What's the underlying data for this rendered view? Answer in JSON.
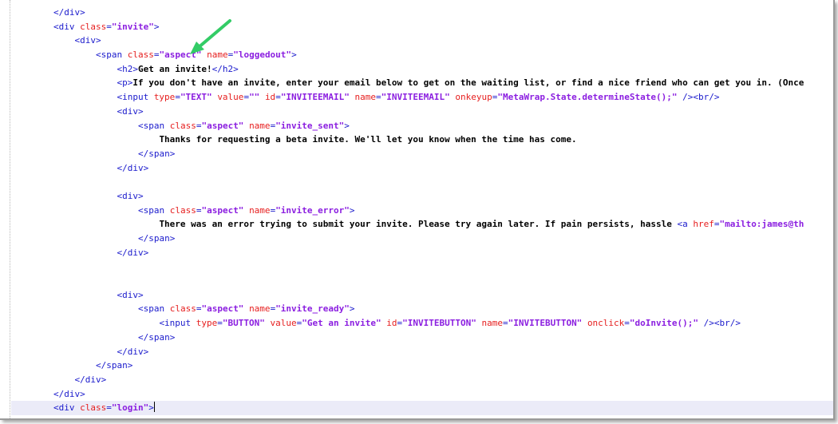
{
  "editor": {
    "accent_arrow_color": "#33cc66",
    "lines": [
      {
        "indent": "        ",
        "parts": [
          [
            "tag",
            "</div>"
          ]
        ]
      },
      {
        "indent": "        ",
        "parts": [
          [
            "tag",
            "<div "
          ],
          [
            "attr",
            "class"
          ],
          [
            "tag",
            "="
          ],
          [
            "val",
            "\"invite\""
          ],
          [
            "tag",
            ">"
          ]
        ]
      },
      {
        "indent": "            ",
        "parts": [
          [
            "tag",
            "<div>"
          ]
        ]
      },
      {
        "indent": "                ",
        "parts": [
          [
            "tag",
            "<span "
          ],
          [
            "attr",
            "class"
          ],
          [
            "tag",
            "="
          ],
          [
            "val",
            "\"aspect\""
          ],
          [
            "tag",
            " "
          ],
          [
            "attr",
            "name"
          ],
          [
            "tag",
            "="
          ],
          [
            "val",
            "\"loggedout\""
          ],
          [
            "tag",
            ">"
          ]
        ]
      },
      {
        "indent": "                    ",
        "parts": [
          [
            "tag",
            "<h2>"
          ],
          [
            "txt",
            "Get an invite!"
          ],
          [
            "tag",
            "</h2>"
          ]
        ]
      },
      {
        "indent": "                    ",
        "parts": [
          [
            "tag",
            "<p>"
          ],
          [
            "txt",
            "If you don't have an invite, enter your email below to get on the waiting list, or find a nice friend who can get you in. (Once"
          ]
        ]
      },
      {
        "indent": "                    ",
        "parts": [
          [
            "tag",
            "<input "
          ],
          [
            "attr",
            "type"
          ],
          [
            "tag",
            "="
          ],
          [
            "val",
            "\"TEXT\""
          ],
          [
            "tag",
            " "
          ],
          [
            "attr",
            "value"
          ],
          [
            "tag",
            "="
          ],
          [
            "val",
            "\"\""
          ],
          [
            "tag",
            " "
          ],
          [
            "attr",
            "id"
          ],
          [
            "tag",
            "="
          ],
          [
            "val",
            "\"INVITEEMAIL\""
          ],
          [
            "tag",
            " "
          ],
          [
            "attr",
            "name"
          ],
          [
            "tag",
            "="
          ],
          [
            "val",
            "\"INVITEEMAIL\""
          ],
          [
            "tag",
            " "
          ],
          [
            "attr",
            "onkeyup"
          ],
          [
            "tag",
            "="
          ],
          [
            "val",
            "\"MetaWrap.State.determineState();\""
          ],
          [
            "tag",
            " /><br/>"
          ]
        ]
      },
      {
        "indent": "                    ",
        "parts": [
          [
            "tag",
            "<div>"
          ]
        ]
      },
      {
        "indent": "                        ",
        "parts": [
          [
            "tag",
            "<span "
          ],
          [
            "attr",
            "class"
          ],
          [
            "tag",
            "="
          ],
          [
            "val",
            "\"aspect\""
          ],
          [
            "tag",
            " "
          ],
          [
            "attr",
            "name"
          ],
          [
            "tag",
            "="
          ],
          [
            "val",
            "\"invite_sent\""
          ],
          [
            "tag",
            ">"
          ]
        ]
      },
      {
        "indent": "                            ",
        "parts": [
          [
            "txt",
            "Thanks for requesting a beta invite. We'll let you know when the time has come."
          ]
        ]
      },
      {
        "indent": "                        ",
        "parts": [
          [
            "tag",
            "</span>"
          ]
        ]
      },
      {
        "indent": "                    ",
        "parts": [
          [
            "tag",
            "</div>"
          ]
        ]
      },
      {
        "indent": "",
        "parts": []
      },
      {
        "indent": "                    ",
        "parts": [
          [
            "tag",
            "<div>"
          ]
        ]
      },
      {
        "indent": "                        ",
        "parts": [
          [
            "tag",
            "<span "
          ],
          [
            "attr",
            "class"
          ],
          [
            "tag",
            "="
          ],
          [
            "val",
            "\"aspect\""
          ],
          [
            "tag",
            " "
          ],
          [
            "attr",
            "name"
          ],
          [
            "tag",
            "="
          ],
          [
            "val",
            "\"invite_error\""
          ],
          [
            "tag",
            ">"
          ]
        ]
      },
      {
        "indent": "                            ",
        "parts": [
          [
            "txt",
            "There was an error trying to submit your invite. Please try again later. If pain persists, hassle "
          ],
          [
            "tag",
            "<a "
          ],
          [
            "attr",
            "href"
          ],
          [
            "tag",
            "="
          ],
          [
            "val",
            "\"mailto:james@th"
          ]
        ]
      },
      {
        "indent": "                        ",
        "parts": [
          [
            "tag",
            "</span>"
          ]
        ]
      },
      {
        "indent": "                    ",
        "parts": [
          [
            "tag",
            "</div>"
          ]
        ]
      },
      {
        "indent": "",
        "parts": []
      },
      {
        "indent": "",
        "parts": []
      },
      {
        "indent": "                    ",
        "parts": [
          [
            "tag",
            "<div>"
          ]
        ]
      },
      {
        "indent": "                        ",
        "parts": [
          [
            "tag",
            "<span "
          ],
          [
            "attr",
            "class"
          ],
          [
            "tag",
            "="
          ],
          [
            "val",
            "\"aspect\""
          ],
          [
            "tag",
            " "
          ],
          [
            "attr",
            "name"
          ],
          [
            "tag",
            "="
          ],
          [
            "val",
            "\"invite_ready\""
          ],
          [
            "tag",
            ">"
          ]
        ]
      },
      {
        "indent": "                            ",
        "parts": [
          [
            "tag",
            "<input "
          ],
          [
            "attr",
            "type"
          ],
          [
            "tag",
            "="
          ],
          [
            "val",
            "\"BUTTON\""
          ],
          [
            "tag",
            " "
          ],
          [
            "attr",
            "value"
          ],
          [
            "tag",
            "="
          ],
          [
            "val",
            "\"Get an invite\""
          ],
          [
            "tag",
            " "
          ],
          [
            "attr",
            "id"
          ],
          [
            "tag",
            "="
          ],
          [
            "val",
            "\"INVITEBUTTON\""
          ],
          [
            "tag",
            " "
          ],
          [
            "attr",
            "name"
          ],
          [
            "tag",
            "="
          ],
          [
            "val",
            "\"INVITEBUTTON\""
          ],
          [
            "tag",
            " "
          ],
          [
            "attr",
            "onclick"
          ],
          [
            "tag",
            "="
          ],
          [
            "val",
            "\"doInvite();\""
          ],
          [
            "tag",
            " /><br/>"
          ]
        ]
      },
      {
        "indent": "                        ",
        "parts": [
          [
            "tag",
            "</span>"
          ]
        ]
      },
      {
        "indent": "                    ",
        "parts": [
          [
            "tag",
            "</div>"
          ]
        ]
      },
      {
        "indent": "                ",
        "parts": [
          [
            "tag",
            "</span>"
          ]
        ]
      },
      {
        "indent": "            ",
        "parts": [
          [
            "tag",
            "</div>"
          ]
        ]
      },
      {
        "indent": "        ",
        "parts": [
          [
            "tag",
            "</div>"
          ]
        ]
      },
      {
        "indent": "        ",
        "parts": [
          [
            "tag",
            "<div "
          ],
          [
            "attr",
            "class"
          ],
          [
            "tag",
            "="
          ],
          [
            "val",
            "\"login\""
          ],
          [
            "tag",
            ">"
          ]
        ],
        "current": true
      }
    ]
  }
}
